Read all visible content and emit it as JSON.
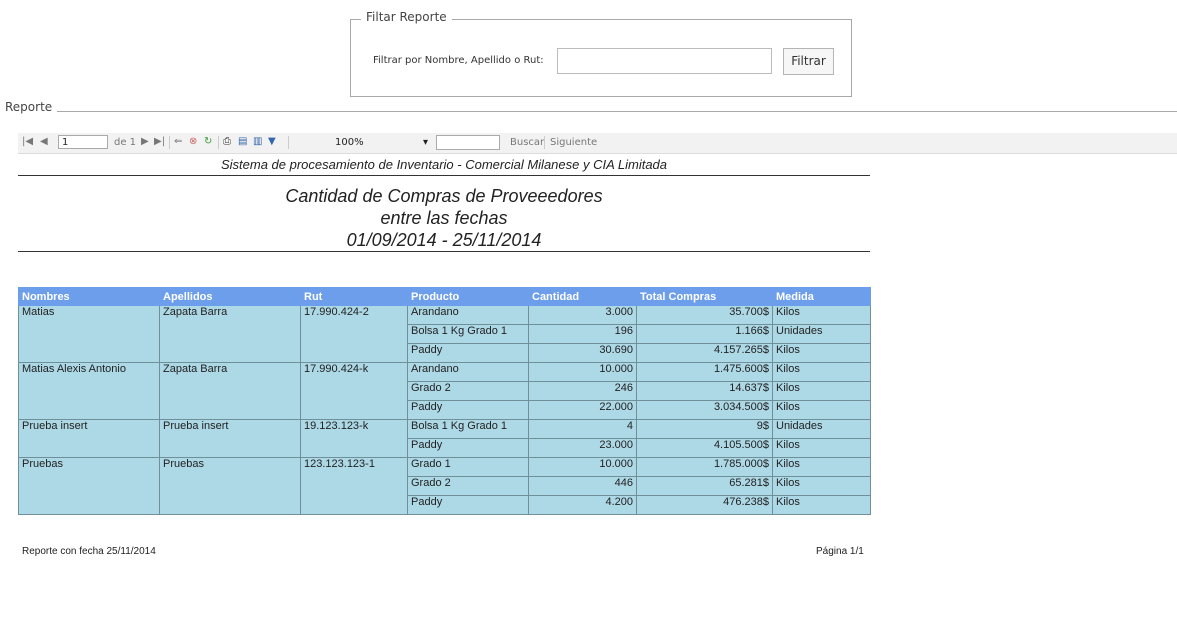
{
  "filter": {
    "legend": "Filtar Reporte",
    "label": "Filtrar por Nombre, Apellido o Rut:",
    "input_value": "",
    "button": "Filtrar"
  },
  "report_legend": "Reporte",
  "toolbar": {
    "page_value": "1",
    "of_label": "de 1",
    "zoom": "100%",
    "search_value": "",
    "find_label": "Buscar",
    "next_label": "Siguiente"
  },
  "report": {
    "header": "Sistema de procesamiento de Inventario - Comercial Milanese y CIA Limitada",
    "title_line1": "Cantidad de Compras de Proveeedores",
    "title_line2": "entre las fechas",
    "title_line3": "01/09/2014 - 25/11/2014",
    "columns": [
      "Nombres",
      "Apellidos",
      "Rut",
      "Producto",
      "Cantidad",
      "Total Compras",
      "Medida"
    ],
    "groups": [
      {
        "nombre": "Matias",
        "apellido": "Zapata Barra",
        "rut": "17.990.424-2",
        "rows": [
          [
            "Arandano",
            "3.000",
            "35.700$",
            "Kilos"
          ],
          [
            "Bolsa 1 Kg Grado 1",
            "196",
            "1.166$",
            "Unidades"
          ],
          [
            "Paddy",
            "30.690",
            "4.157.265$",
            "Kilos"
          ]
        ]
      },
      {
        "nombre": "Matias Alexis Antonio",
        "apellido": "Zapata Barra",
        "rut": "17.990.424-k",
        "rows": [
          [
            "Arandano",
            "10.000",
            "1.475.600$",
            "Kilos"
          ],
          [
            "Grado 2",
            "246",
            "14.637$",
            "Kilos"
          ],
          [
            "Paddy",
            "22.000",
            "3.034.500$",
            "Kilos"
          ]
        ]
      },
      {
        "nombre": "Prueba insert",
        "apellido": "Prueba insert",
        "rut": "19.123.123-k",
        "rows": [
          [
            "Bolsa 1 Kg Grado 1",
            "4",
            "9$",
            "Unidades"
          ],
          [
            "Paddy",
            "23.000",
            "4.105.500$",
            "Kilos"
          ]
        ]
      },
      {
        "nombre": "Pruebas",
        "apellido": "Pruebas",
        "rut": "123.123.123-1",
        "rows": [
          [
            "Grado 1",
            "10.000",
            "1.785.000$",
            "Kilos"
          ],
          [
            "Grado 2",
            "446",
            "65.281$",
            "Kilos"
          ],
          [
            "Paddy",
            "4.200",
            "476.238$",
            "Kilos"
          ]
        ]
      }
    ],
    "footer_left": "Reporte con fecha 25/11/2014",
    "footer_right": "Página 1/1"
  }
}
